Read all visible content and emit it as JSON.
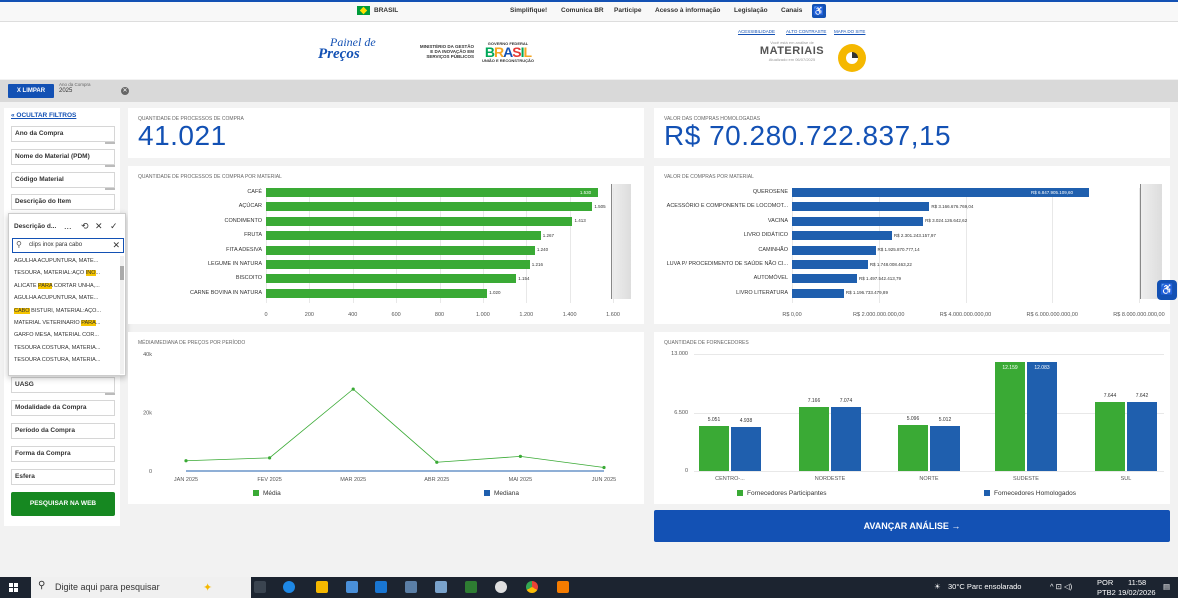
{
  "govbar": {
    "country": "BRASIL",
    "links": [
      "Simplifique!",
      "Comunica BR",
      "Participe",
      "Acesso à informação",
      "Legislação",
      "Canais"
    ]
  },
  "header": {
    "logo_line1": "Painel de",
    "logo_line2": "Preços",
    "ministry": "MINISTÉRIO DA GESTÃO E DA INOVAÇÃO EM SERVIÇOS PÚBLICOS",
    "gov_label": "GOVERNO FEDERAL",
    "brasil_word": [
      "B",
      "R",
      "A",
      "S",
      "I",
      "L"
    ],
    "brasil_tagline": "UNIÃO E RECONSTRUÇÃO",
    "top_links": [
      "ACESSIBILIDADE",
      "ALTO CONTRASTE",
      "MAPA DO SITE"
    ],
    "panel_small": "Você está em análise de",
    "panel_title": "MATERIAIS",
    "panel_updated": "Atualizado em 06/07/2025"
  },
  "filterbar": {
    "clear_label": "X  LIMPAR",
    "chip_label": "Ano da Compra",
    "chip_value": "2025"
  },
  "sidebar": {
    "hide_filters": "« OCULTAR FILTROS",
    "filters_top": [
      "Ano da Compra",
      "Nome do Material (PDM)",
      "Código Material",
      "Descrição do Item"
    ],
    "filters_bottom": [
      "UASG",
      "Modalidade da Compra",
      "Período da Compra",
      "Forma da Compra",
      "Esfera"
    ],
    "search_button": "PESQUISAR NA WEB"
  },
  "popup": {
    "title": "Descrição d...",
    "icons": [
      "...",
      "⟲",
      "✕",
      "✓"
    ],
    "search_value": "clips inox para cabo",
    "items": [
      {
        "pre": "AGULHA ACUPUNTURA, MATE...",
        "hl": "",
        "post": ""
      },
      {
        "pre": "TESOURA, MATERIAL:AÇO ",
        "hl": "INO",
        "post": "..."
      },
      {
        "pre": "ALICATE ",
        "hl": "PARA",
        "post": " CORTAR UNHA,..."
      },
      {
        "pre": "AGULHA ACUPUNTURA, MATE...",
        "hl": "",
        "post": ""
      },
      {
        "pre": "",
        "hl": "CABO",
        "post": " BISTURI, MATERIAL:AÇO..."
      },
      {
        "pre": "MATERIAL VETERINÁRIO ",
        "hl": "PARA",
        "post": "..."
      },
      {
        "pre": "GARFO MESA, MATERIAL COR...",
        "hl": "",
        "post": ""
      },
      {
        "pre": "TESOURA COSTURA, MATERIA...",
        "hl": "",
        "post": ""
      },
      {
        "pre": "TESOURA COSTURA, MATERIA...",
        "hl": "",
        "post": ""
      }
    ]
  },
  "kpi1": {
    "label": "QUANTIDADE DE PROCESSOS DE COMPRA",
    "value": "41.021"
  },
  "kpi2": {
    "label": "VALOR DAS COMPRAS HOMOLOGADAS",
    "value": "R$ 70.280.722.837,15"
  },
  "chart_data": [
    {
      "type": "bar",
      "orientation": "horizontal",
      "title": "QUANTIDADE DE PROCESSOS DE COMPRA POR MATERIAL",
      "categories": [
        "CAFÉ",
        "AÇÚCAR",
        "CONDIMENTO",
        "FRUTA",
        "FITA ADESIVA",
        "LEGUME IN NATURA",
        "BISCOITO",
        "CARNE BOVINA IN NATURA"
      ],
      "values": [
        1530,
        1505,
        1413,
        1267,
        1240,
        1216,
        1154,
        1020
      ],
      "value_labels": [
        "1.530",
        "1.505",
        "1.413",
        "1.267",
        "1.240",
        "1.216",
        "1.154",
        "1.020"
      ],
      "xlim": [
        0,
        1600
      ],
      "ticks": [
        "0",
        "200",
        "400",
        "600",
        "800",
        "1.000",
        "1.200",
        "1.400",
        "1.600"
      ],
      "color": "#3aaa35"
    },
    {
      "type": "bar",
      "orientation": "horizontal",
      "title": "VALOR DE COMPRAS POR MATERIAL",
      "categories": [
        "QUEROSENE",
        "ACESSÓRIO E COMPONENTE DE LOCOMOT...",
        "VACINA",
        "LIVRO DIDÁTICO",
        "CAMINHÃO",
        "LUVA P/ PROCEDIMENTO DE SAÚDE NÃO CI...",
        "AUTOMÓVEL",
        "LIVRO LITERATURA"
      ],
      "values": [
        6847905109.6,
        3166676769.04,
        3024126642.62,
        2301243157.97,
        1925870777.14,
        1748008463.22,
        1497542413.79,
        1196733479.89
      ],
      "value_labels": [
        "R$ 6.847.905.109,60",
        "R$ 3.166.676.769,04",
        "R$ 3.024.126.642,62",
        "R$ 2.301.243.157,97",
        "R$ 1.925.870.777,14",
        "R$ 1.748.008.463,22",
        "R$ 1.497.542.413,79",
        "R$ 1.196.733.479,89"
      ],
      "xlim": [
        0,
        8000000000
      ],
      "ticks": [
        "R$ 0,00",
        "R$ 2.000.000.000,00",
        "R$ 4.000.000.000,00",
        "R$ 6.000.000.000,00",
        "R$ 8.000.000.000,00"
      ],
      "color": "#1f5fae"
    },
    {
      "type": "line",
      "title": "MÉDIA/MEDIANA DE PREÇOS POR PERÍODO",
      "x": [
        "JAN 2025",
        "FEV 2025",
        "MAR 2025",
        "ABR 2025",
        "MAI 2025",
        "JUN 2025"
      ],
      "series": [
        {
          "name": "Média",
          "values": [
            3500,
            4500,
            28000,
            3000,
            5000,
            1200
          ],
          "color": "#3aaa35"
        },
        {
          "name": "Mediana",
          "values": [
            0,
            0,
            0,
            0,
            0,
            0
          ],
          "color": "#1f5fae"
        }
      ],
      "ylim": [
        0,
        40000
      ],
      "yticks": [
        "0",
        "20k",
        "40k"
      ]
    },
    {
      "type": "bar",
      "title": "QUANTIDADE DE FORNECEDORES",
      "categories": [
        "CENTRO-...",
        "NORDESTE",
        "NORTE",
        "SUDESTE",
        "SUL"
      ],
      "series": [
        {
          "name": "Fornecedores Participantes",
          "values": [
            5051,
            7166,
            5096,
            12159,
            7644
          ],
          "labels": [
            "5.051",
            "7.166",
            "5.096",
            "12.159",
            "7.644"
          ],
          "color": "#3aaa35"
        },
        {
          "name": "Fornecedores Homologados",
          "values": [
            4938,
            7074,
            5012,
            12083,
            7642
          ],
          "labels": [
            "4.938",
            "7.074",
            "5.012",
            "12.083",
            "7.642"
          ],
          "color": "#1f5fae"
        }
      ],
      "ylim": [
        0,
        13000
      ],
      "yticks": [
        "0",
        "6.500",
        "13.000"
      ]
    }
  ],
  "advance_button": "AVANÇAR ANÁLISE  →",
  "taskbar": {
    "search_placeholder": "Digite aqui para pesquisar",
    "weather": "30°C  Parc ensolarado",
    "lang": "POR",
    "lang2": "PTB2",
    "time": "11:58",
    "date": "19/02/2026"
  }
}
